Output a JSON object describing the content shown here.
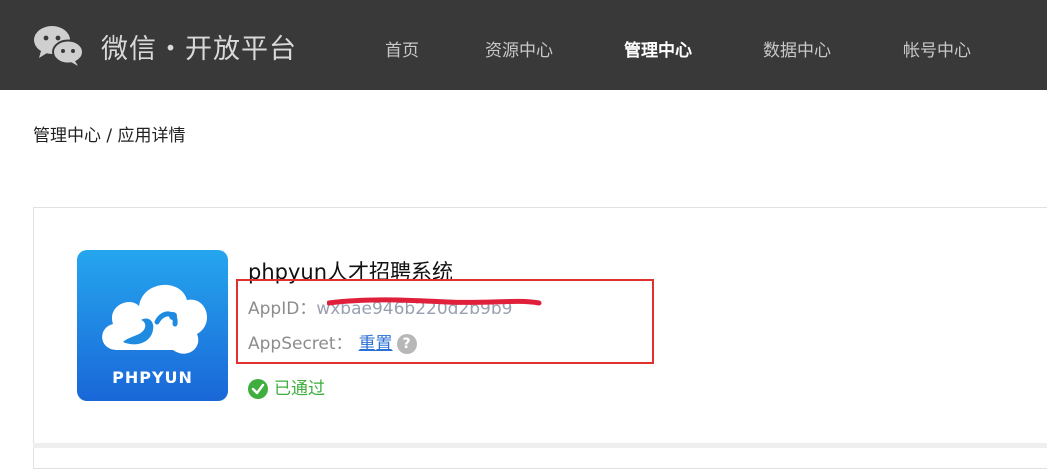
{
  "header": {
    "brand": "微信・开放平台",
    "nav": [
      {
        "label": "首页",
        "active": false
      },
      {
        "label": "资源中心",
        "active": false
      },
      {
        "label": "管理中心",
        "active": true
      },
      {
        "label": "数据中心",
        "active": false
      },
      {
        "label": "帐号中心",
        "active": false
      }
    ]
  },
  "breadcrumb": "管理中心 / 应用详情",
  "app": {
    "icon_text": "PHPYUN",
    "name": "phpyun人才招聘系统",
    "appid_label": "AppID：",
    "appid_value": "wxbae946b220d2b9b9",
    "appsecret_label": "AppSecret：",
    "reset_label": "重置",
    "help_icon": "question-circle-icon",
    "status": "已通过"
  },
  "colors": {
    "header_bg": "#393939",
    "link": "#2a6fd6",
    "success": "#3fae3f",
    "highlight": "#e03030",
    "icon_bg": "#1f8be0"
  }
}
